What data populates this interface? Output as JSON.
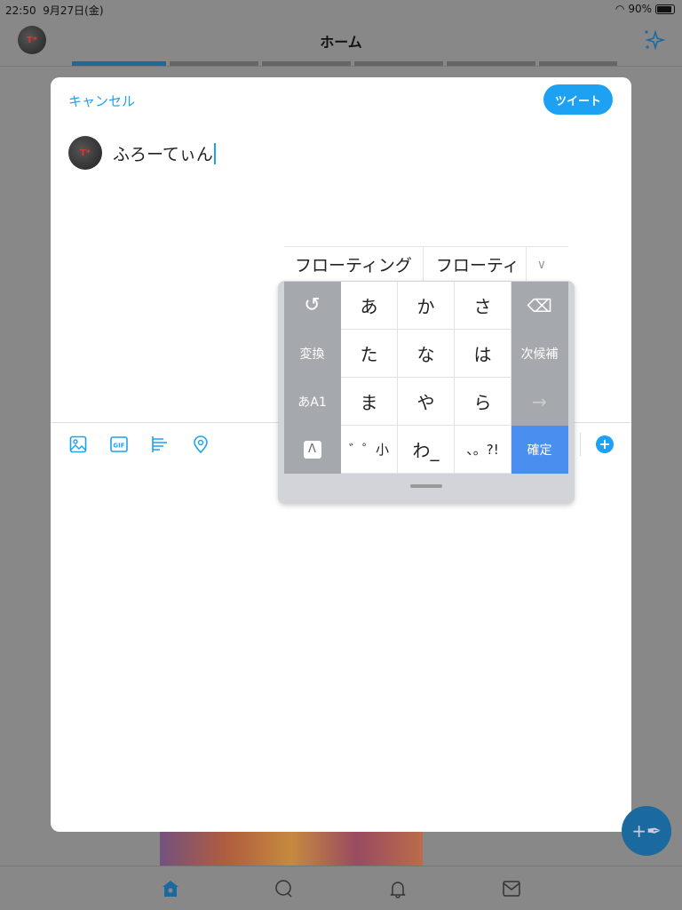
{
  "status": {
    "time": "22:50",
    "date": "9月27日(金)",
    "battery": "90%",
    "battery_level": 0.9
  },
  "header": {
    "title": "ホーム",
    "avatar_text": "T*",
    "tabs_count_active": 0
  },
  "compose": {
    "cancel": "キャンセル",
    "tweet": "ツイート",
    "text": "ふろーてぃん",
    "avatar_text": "T*"
  },
  "toolbar": {
    "icons": [
      "image-icon",
      "gif-icon",
      "poll-icon",
      "location-icon"
    ],
    "gif_label": "GIF",
    "add": "+"
  },
  "keyboard": {
    "candidates": [
      "フローティング",
      "フローティ"
    ],
    "keys": [
      [
        "↺",
        "あ",
        "か",
        "さ",
        "⌫"
      ],
      [
        "変換",
        "た",
        "な",
        "は",
        "次候補"
      ],
      [
        "あA1",
        "ま",
        "や",
        "ら",
        "→"
      ],
      [
        "Λ",
        "゛゜小",
        "わ_",
        "、。?!",
        "確定"
      ]
    ]
  },
  "colors": {
    "accent": "#1da1f2",
    "confirm": "#4a8ff0"
  }
}
